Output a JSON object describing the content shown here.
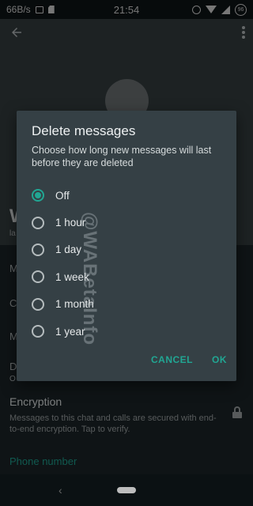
{
  "status_bar": {
    "speed": "66B/s",
    "time": "21:54",
    "battery": "96"
  },
  "background": {
    "contact_name_initial": "W",
    "row_fragments": [
      "la",
      "M",
      "C",
      "M",
      "D",
      "O"
    ]
  },
  "encryption": {
    "title": "Encryption",
    "description": "Messages to this chat and calls are secured with end-to-end encryption. Tap to verify."
  },
  "phone_section_label": "Phone number",
  "dialog": {
    "title": "Delete messages",
    "description": "Choose how long new messages will last before they are deleted",
    "options": [
      {
        "label": "Off",
        "selected": true
      },
      {
        "label": "1 hour",
        "selected": false
      },
      {
        "label": "1 day",
        "selected": false
      },
      {
        "label": "1 week",
        "selected": false
      },
      {
        "label": "1 month",
        "selected": false
      },
      {
        "label": "1 year",
        "selected": false
      }
    ],
    "cancel_label": "CANCEL",
    "ok_label": "OK"
  },
  "watermark": "@WABetaInfo",
  "colors": {
    "accent": "#21a693",
    "dialog_bg": "#354045"
  }
}
